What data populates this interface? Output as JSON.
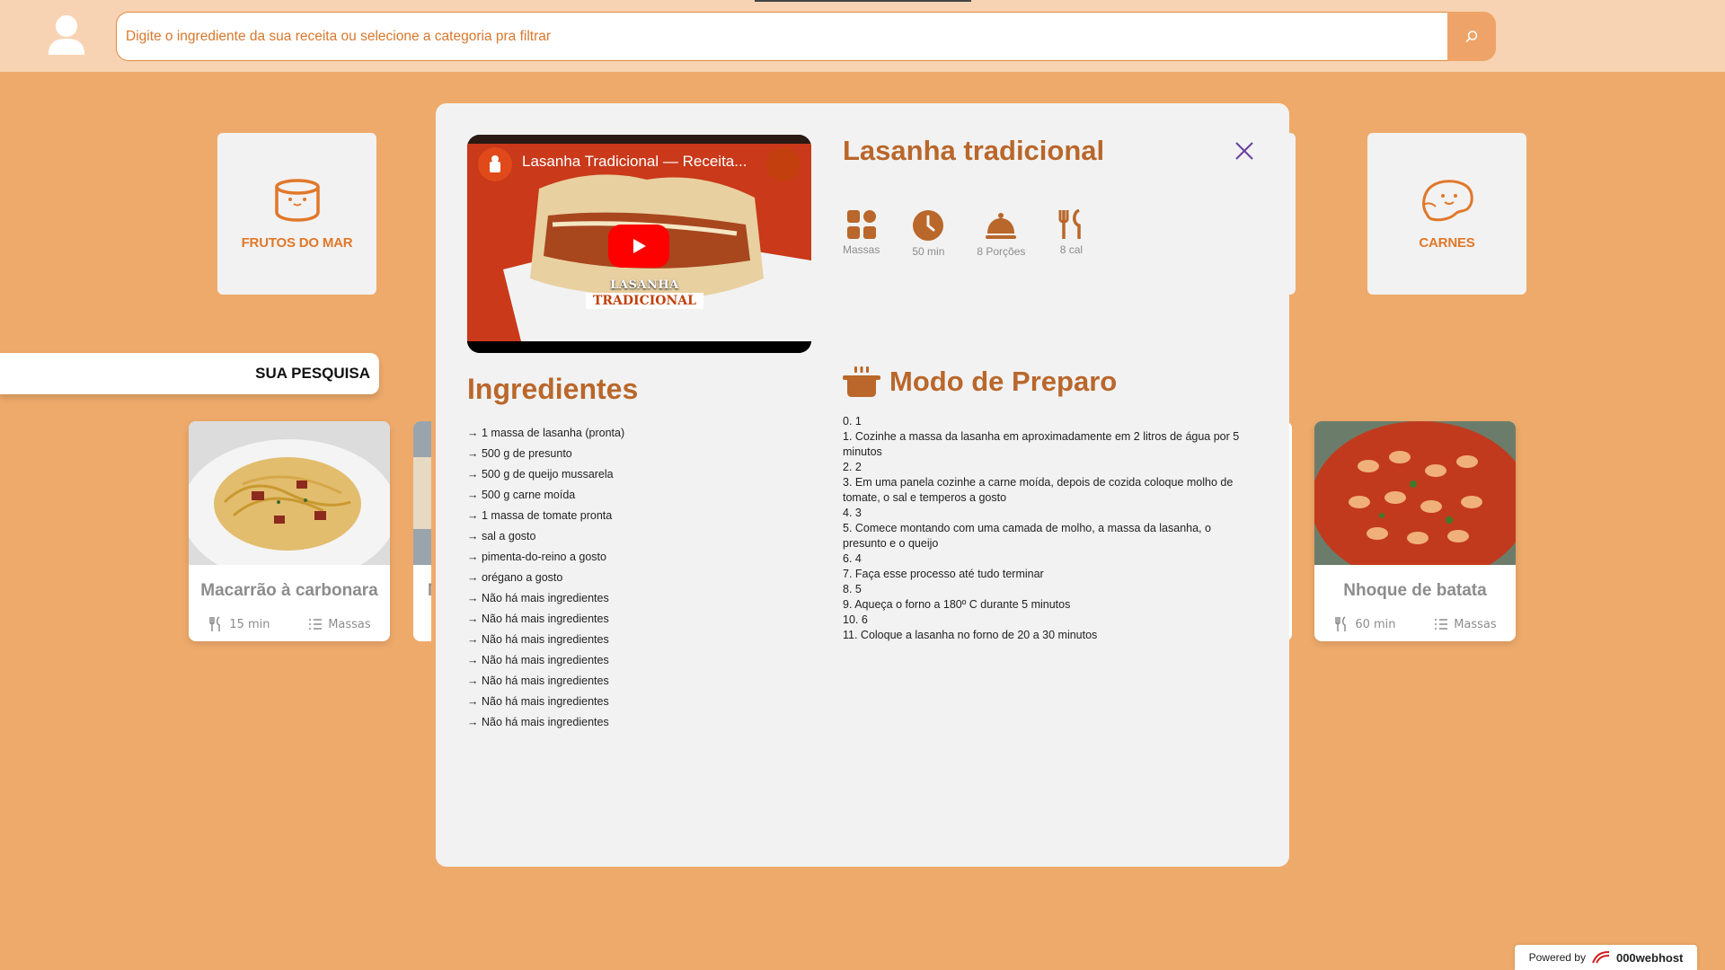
{
  "search": {
    "placeholder": "Digite o ingrediente da sua receita ou selecione a categoria pra filtrar"
  },
  "categories": [
    {
      "label": "FRUTOS DO MAR",
      "icon": "can-icon"
    },
    {
      "label": "CARNES",
      "icon": "meat-icon"
    }
  ],
  "sua_pesquisa": "SUA PESQUISA",
  "recipes": [
    {
      "title": "Macarrão à carbonara",
      "time": "15 min",
      "category": "Massas"
    },
    {
      "title": "Nhoque de batata",
      "time": "60 min",
      "category": "Massas"
    }
  ],
  "partial_card_letter": "M",
  "modal": {
    "title": "Lasanha tradicional",
    "video": {
      "title": "Lasanha Tradicional — Receita...",
      "caption_line1": "LASANHA",
      "caption_line2": "TRADICIONAL"
    },
    "info": [
      {
        "icon": "grid-icon",
        "label": "Massas"
      },
      {
        "icon": "clock-icon",
        "label": "50 min"
      },
      {
        "icon": "cloche-icon",
        "label": "8 Porções"
      },
      {
        "icon": "utensils-icon",
        "label": "8 cal"
      }
    ],
    "ingredients_title": "Ingredientes",
    "ingredients": [
      "1 massa de lasanha (pronta)",
      "500 g de presunto",
      "500 g de queijo mussarela",
      "500 g carne moída",
      "1 massa de tomate pronta",
      "sal a gosto",
      "pimenta-do-reino a gosto",
      "orégano a gosto",
      "Não há mais ingredientes",
      "Não há mais ingredientes",
      "Não há mais ingredientes",
      "Não há mais ingredientes",
      "Não há mais ingredientes",
      "Não há mais ingredientes",
      "Não há mais ingredientes"
    ],
    "prep_title": "Modo de Preparo",
    "prep_steps": [
      "0. 1",
      "1. Cozinhe a massa da lasanha em aproximadamente em 2 litros de água por 5 minutos",
      "2. 2",
      "3. Em uma panela cozinhe a carne moída, depois de cozida coloque molho de tomate, o sal e temperos a gosto",
      "4. 3",
      "5. Comece montando com uma camada de molho, a massa da lasanha, o presunto e o queijo",
      "6. 4",
      "7. Faça esse processo até tudo terminar",
      "8. 5",
      "9. Aqueça o forno a 180º C durante 5 minutos",
      "10. 6",
      "11. Coloque a lasanha no forno de 20 a 30 minutos"
    ]
  },
  "footer": {
    "powered_by": "Powered by",
    "brand": "000webhost"
  },
  "colors": {
    "background": "#eeaa6b",
    "header": "#f8d3b3",
    "accent": "#e0782a",
    "title_brown": "#b9672b",
    "close_purple": "#6b3fa0"
  }
}
